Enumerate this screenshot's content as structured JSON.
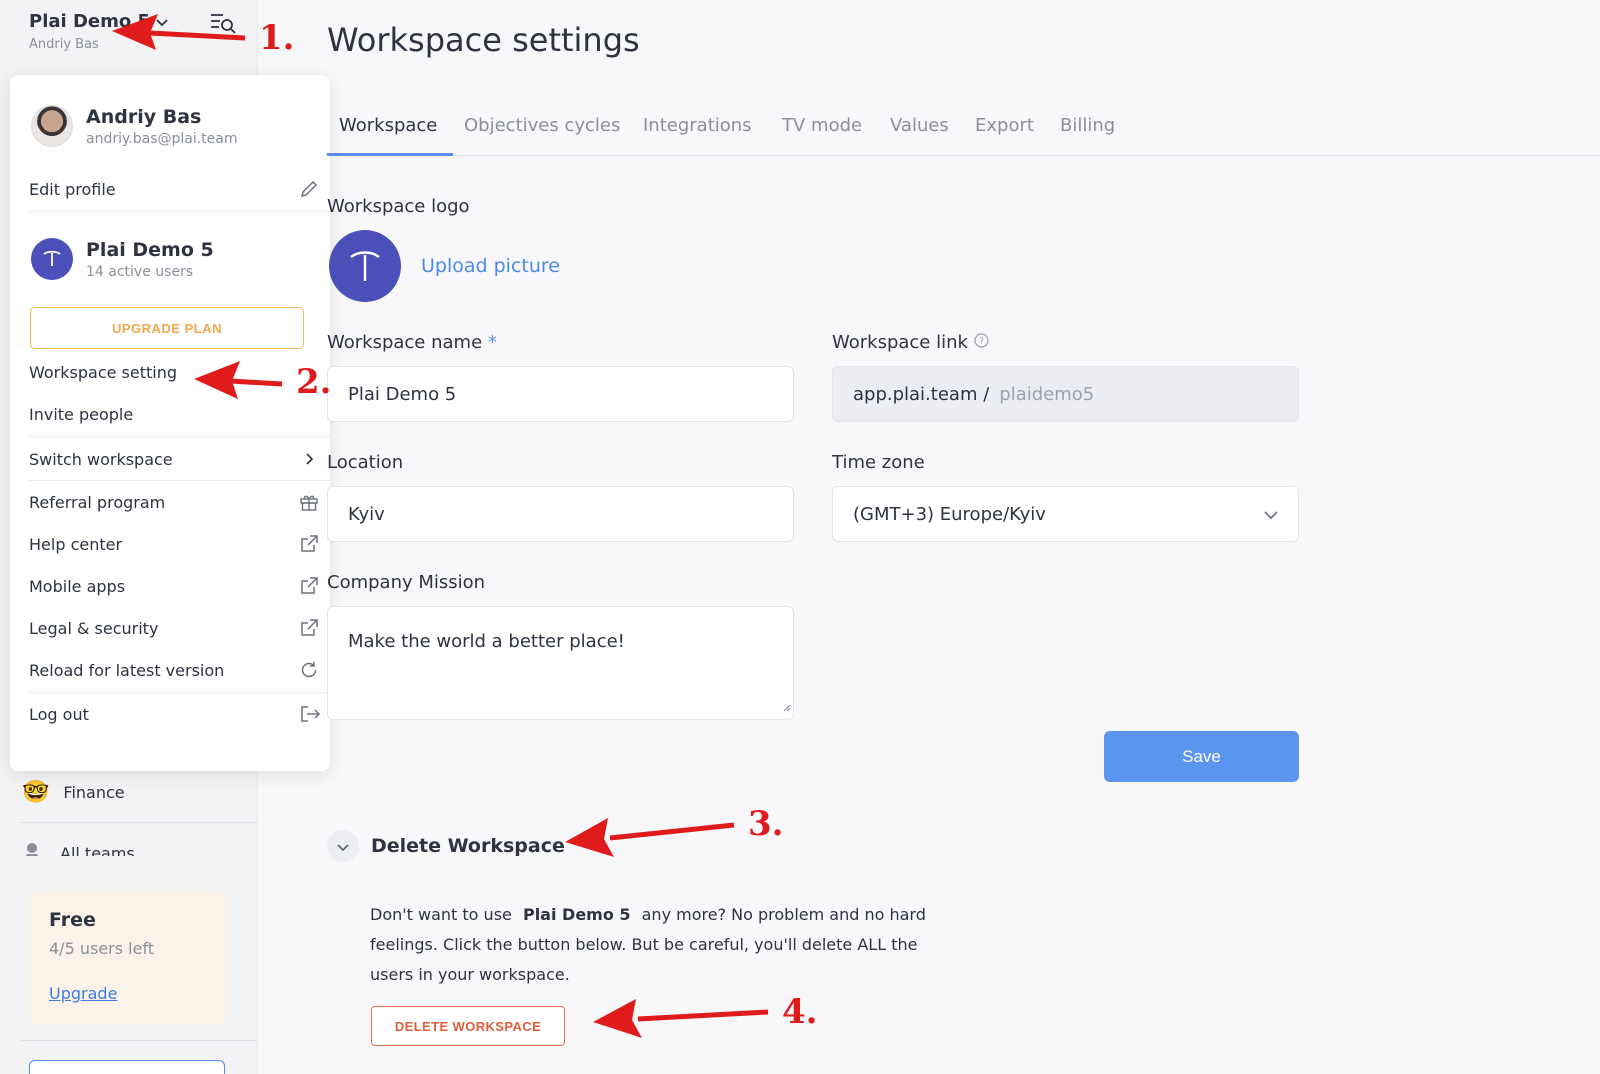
{
  "sidebar": {
    "workspace_title": "Plai Demo 5",
    "user_name": "Andriy Bas",
    "team_finance": "Finance",
    "team_all": "All teams",
    "plan": {
      "title": "Free",
      "subtitle": "4/5 users left",
      "link": "Upgrade"
    }
  },
  "menu": {
    "user": {
      "name": "Andriy Bas",
      "email": "andriy.bas@plai.team"
    },
    "edit_profile": "Edit profile",
    "workspace": {
      "name": "Plai Demo 5",
      "users": "14 active users"
    },
    "upgrade_plan": "UPGRADE PLAN",
    "workspace_setting": "Workspace setting",
    "invite_people": "Invite people",
    "switch_workspace": "Switch workspace",
    "referral_program": "Referral program",
    "help_center": "Help center",
    "mobile_apps": "Mobile apps",
    "legal_security": "Legal & security",
    "reload": "Reload for latest version",
    "log_out": "Log out"
  },
  "main": {
    "title": "Workspace settings",
    "tabs": [
      "Workspace",
      "Objectives cycles",
      "Integrations",
      "TV mode",
      "Values",
      "Export",
      "Billing"
    ],
    "logo_label": "Workspace logo",
    "upload_picture": "Upload picture",
    "name_label": "Workspace name",
    "required_mark": "*",
    "name_value": "Plai Demo 5",
    "link_label": "Workspace link",
    "link_prefix": "app.plai.team /",
    "link_value": "plaidemo5",
    "location_label": "Location",
    "location_value": "Kyiv",
    "timezone_label": "Time zone",
    "timezone_value": "(GMT+3) Europe/Kyiv",
    "mission_label": "Company Mission",
    "mission_value": "Make the world a better place!",
    "save": "Save",
    "delete_section": {
      "title": "Delete Workspace",
      "text_before": "Don't want to use",
      "ws_name": "Plai Demo 5",
      "text_after": "any more? No problem and no hard feelings. Click the button below. But be careful, you'll delete ALL the users in your workspace.",
      "button": "DELETE WORKSPACE"
    }
  },
  "annotations": [
    "1.",
    "2.",
    "3.",
    "4."
  ],
  "colors": {
    "accent": "#5b95f0",
    "brand": "#4b4fb8",
    "danger": "#e0603c",
    "arrow": "#e01b1b",
    "upgrade": "#f0a94f"
  }
}
